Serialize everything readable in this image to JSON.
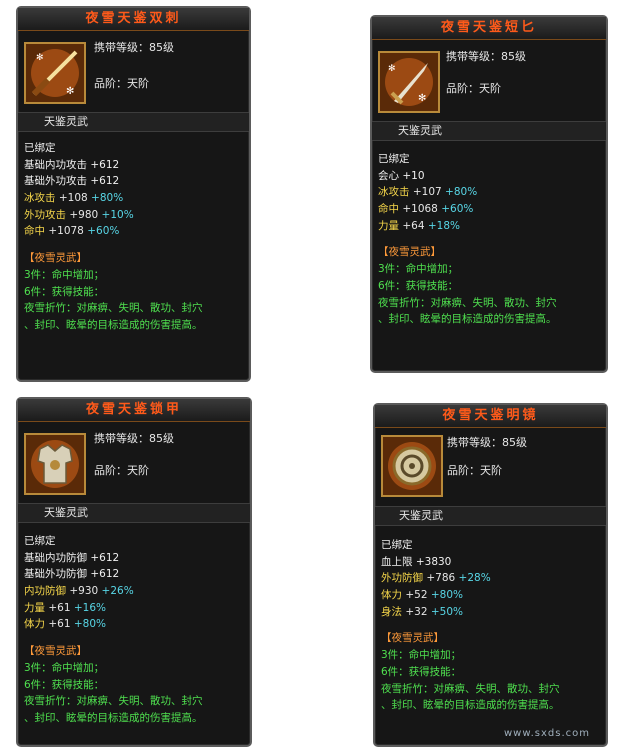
{
  "items": [
    {
      "title": "夜雪天鉴双刺",
      "carry_level": "携带等级：85级",
      "grade": "品阶：天阶",
      "category": "天鉴灵武",
      "icon": "twin-dagger-icon",
      "bound": "已绑定",
      "stats": [
        {
          "name": "基础内功攻击",
          "value": "+612",
          "bonus": "",
          "color": "white"
        },
        {
          "name": "基础外功攻击",
          "value": "+612",
          "bonus": "",
          "color": "white"
        },
        {
          "name": "冰攻击",
          "value": "+108",
          "bonus": "+80%",
          "color": "yellow"
        },
        {
          "name": "外功攻击",
          "value": "+980",
          "bonus": "+10%",
          "color": "yellow"
        },
        {
          "name": "命中",
          "value": "+1078",
          "bonus": "+60%",
          "color": "yellow"
        }
      ],
      "set_name": "【夜雪灵武】",
      "set_3": "3件：命中增加；",
      "set_6": "6件：获得技能：",
      "skill_line1": "夜雪折竹：对麻痹、失明、散功、封穴",
      "skill_line2": "、封印、眩晕的目标造成的伤害提高。"
    },
    {
      "title": "夜雪天鉴短匕",
      "carry_level": "携带等级：85级",
      "grade": "品阶：天阶",
      "category": "天鉴灵武",
      "icon": "short-dagger-icon",
      "bound": "已绑定",
      "stats": [
        {
          "name": "会心",
          "value": "+10",
          "bonus": "",
          "color": "white"
        },
        {
          "name": "冰攻击",
          "value": "+107",
          "bonus": "+80%",
          "color": "yellow"
        },
        {
          "name": "命中",
          "value": "+1068",
          "bonus": "+60%",
          "color": "yellow"
        },
        {
          "name": "力量",
          "value": "+64",
          "bonus": "+18%",
          "color": "yellow"
        }
      ],
      "set_name": "【夜雪灵武】",
      "set_3": "3件：命中增加；",
      "set_6": "6件：获得技能：",
      "skill_line1": "夜雪折竹：对麻痹、失明、散功、封穴",
      "skill_line2": "、封印、眩晕的目标造成的伤害提高。"
    },
    {
      "title": "夜雪天鉴锁甲",
      "carry_level": "携带等级：85级",
      "grade": "品阶：天阶",
      "category": "天鉴灵武",
      "icon": "chain-armor-icon",
      "bound": "已绑定",
      "stats": [
        {
          "name": "基础内功防御",
          "value": "+612",
          "bonus": "",
          "color": "white"
        },
        {
          "name": "基础外功防御",
          "value": "+612",
          "bonus": "",
          "color": "white"
        },
        {
          "name": "内功防御",
          "value": "+930",
          "bonus": "+26%",
          "color": "yellow"
        },
        {
          "name": "力量",
          "value": "+61",
          "bonus": "+16%",
          "color": "yellow"
        },
        {
          "name": "体力",
          "value": "+61",
          "bonus": "+80%",
          "color": "yellow"
        }
      ],
      "set_name": "【夜雪灵武】",
      "set_3": "3件：命中增加；",
      "set_6": "6件：获得技能：",
      "skill_line1": "夜雪折竹：对麻痹、失明、散功、封穴",
      "skill_line2": "、封印、眩晕的目标造成的伤害提高。"
    },
    {
      "title": "夜雪天鉴明镜",
      "carry_level": "携带等级：85级",
      "grade": "品阶：天阶",
      "category": "天鉴灵武",
      "icon": "mirror-icon",
      "bound": "已绑定",
      "stats": [
        {
          "name": "血上限",
          "value": "+3830",
          "bonus": "",
          "color": "white"
        },
        {
          "name": "外功防御",
          "value": "+786",
          "bonus": "+28%",
          "color": "yellow"
        },
        {
          "name": "体力",
          "value": "+52",
          "bonus": "+80%",
          "color": "yellow"
        },
        {
          "name": "身法",
          "value": "+32",
          "bonus": "+50%",
          "color": "yellow"
        }
      ],
      "set_name": "【夜雪灵武】",
      "set_3": "3件：命中增加；",
      "set_6": "6件：获得技能：",
      "skill_line1": "夜雪折竹：对麻痹、失明、散功、封穴",
      "skill_line2": "、封印、眩晕的目标造成的伤害提高。"
    }
  ],
  "watermark": "www.sxds.com",
  "colors": {
    "title": "#ff5a1a",
    "stat_base": "#f0f0f0",
    "stat_yellow": "#f5d64a",
    "bonus_cyan": "#58d6e6",
    "set_name": "#ff9a3a",
    "set_text": "#4fe04f",
    "border": "#5b5b5b"
  }
}
